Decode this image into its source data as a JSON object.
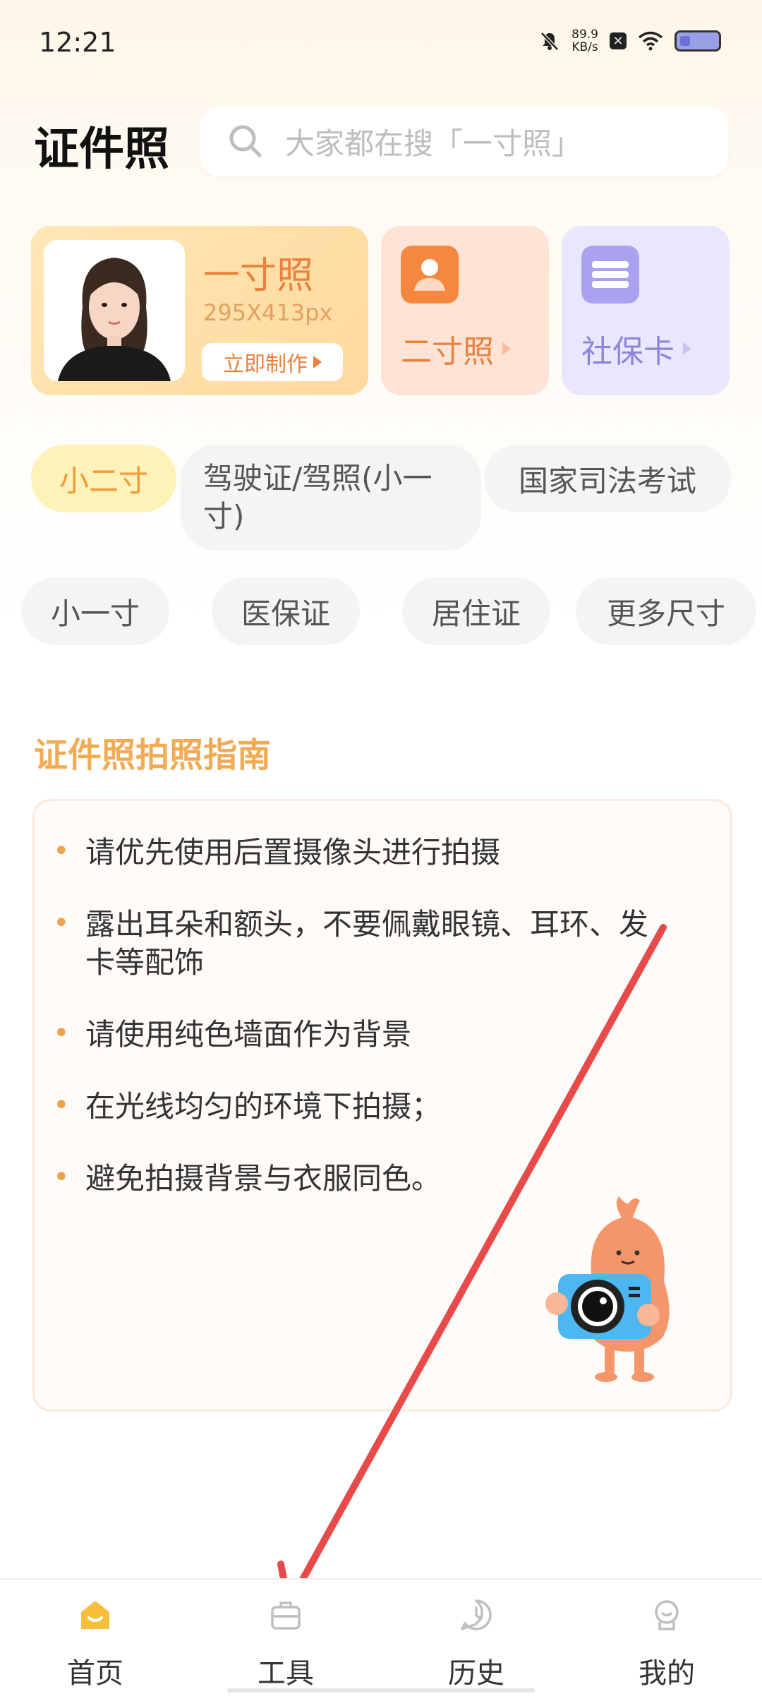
{
  "status_bar": {
    "time": "12:21",
    "net_speed_value": "89.9",
    "net_speed_unit": "KB/s"
  },
  "header": {
    "title": "证件照",
    "search_placeholder": "大家都在搜「一寸照」"
  },
  "cards": {
    "main": {
      "name": "一寸照",
      "size": "295X413px",
      "action": "立即制作"
    },
    "second": {
      "label": "二寸照"
    },
    "third": {
      "label": "社保卡"
    }
  },
  "chips": [
    "小二寸",
    "驾驶证/驾照(小一寸)",
    "国家司法考试",
    "小一寸",
    "医保证",
    "居住证",
    "更多尺寸"
  ],
  "guide": {
    "title": "证件照拍照指南",
    "tips": [
      "请优先使用后置摄像头进行拍摄",
      "露出耳朵和额头，不要佩戴眼镜、耳环、发卡等配饰",
      "请使用纯色墙面作为背景",
      "在光线均匀的环境下拍摄；",
      "避免拍摄背景与衣服同色。"
    ]
  },
  "nav": [
    {
      "label": "首页",
      "icon": "home-icon"
    },
    {
      "label": "工具",
      "icon": "toolbox-icon"
    },
    {
      "label": "历史",
      "icon": "clock-icon"
    },
    {
      "label": "我的",
      "icon": "profile-icon"
    }
  ],
  "colors": {
    "accent": "#f2ab55",
    "orange": "#e8813d",
    "purple": "#8b86d9",
    "arrow": "#e84a4a"
  }
}
